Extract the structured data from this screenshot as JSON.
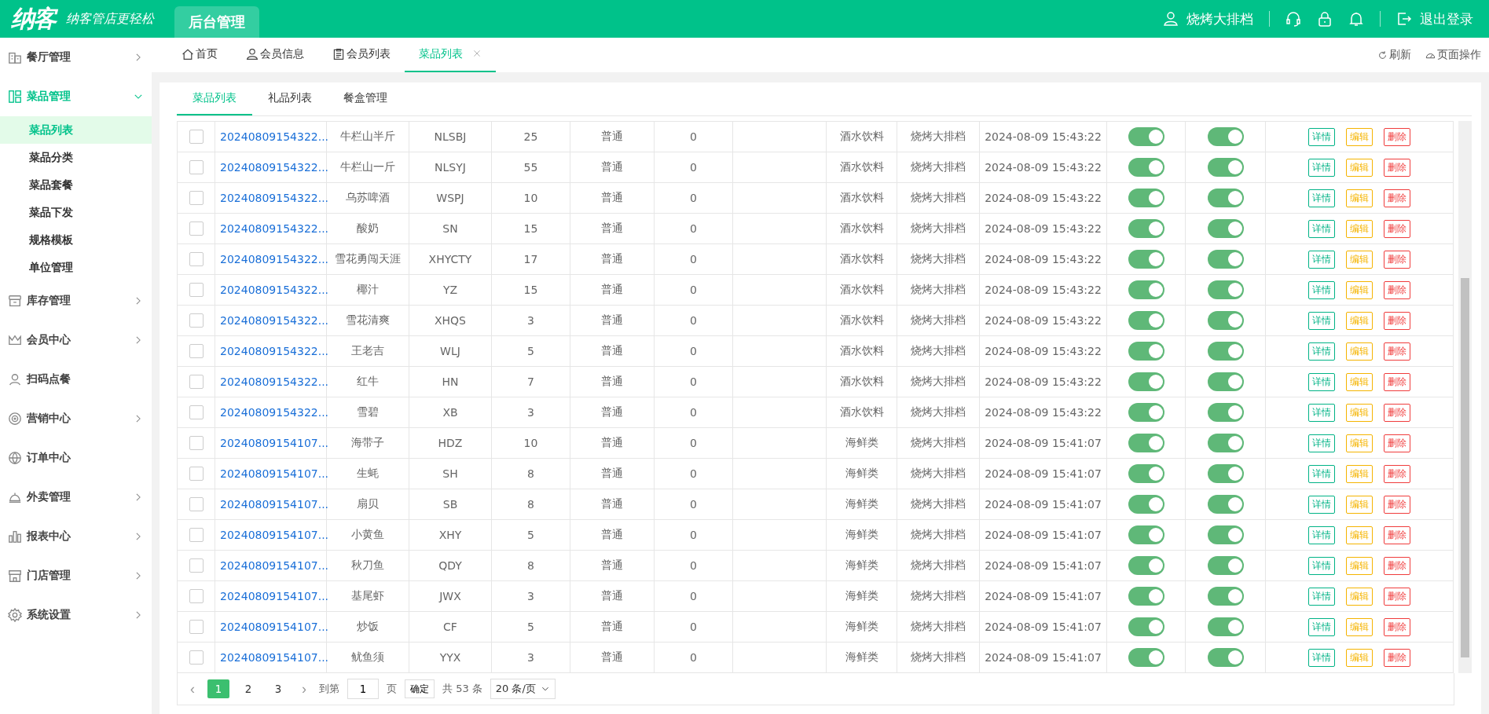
{
  "header": {
    "logo": "纳客",
    "slogan": "纳客管店更轻松",
    "nav": [
      {
        "label": "后台管理",
        "selected": true
      }
    ],
    "user": "烧烤大排档",
    "logout": "退出登录"
  },
  "sidebar": {
    "items": [
      {
        "label": "餐厅管理",
        "expanded": false,
        "has_arrow": true
      },
      {
        "label": "菜品管理",
        "expanded": true,
        "has_arrow": true,
        "children": [
          {
            "label": "菜品列表",
            "selected": true
          },
          {
            "label": "菜品分类",
            "selected": false
          },
          {
            "label": "菜品套餐",
            "selected": false
          },
          {
            "label": "菜品下发",
            "selected": false
          },
          {
            "label": "规格模板",
            "selected": false
          },
          {
            "label": "单位管理",
            "selected": false
          }
        ]
      },
      {
        "label": "库存管理",
        "expanded": false,
        "has_arrow": true
      },
      {
        "label": "会员中心",
        "expanded": false,
        "has_arrow": true
      },
      {
        "label": "扫码点餐",
        "expanded": false,
        "has_arrow": false
      },
      {
        "label": "营销中心",
        "expanded": false,
        "has_arrow": true
      },
      {
        "label": "订单中心",
        "expanded": false,
        "has_arrow": false
      },
      {
        "label": "外卖管理",
        "expanded": false,
        "has_arrow": true
      },
      {
        "label": "报表中心",
        "expanded": false,
        "has_arrow": true
      },
      {
        "label": "门店管理",
        "expanded": false,
        "has_arrow": true
      },
      {
        "label": "系统设置",
        "expanded": false,
        "has_arrow": true
      }
    ]
  },
  "page_tabs": [
    {
      "label": "首页",
      "selected": false,
      "closable": false
    },
    {
      "label": "会员信息",
      "selected": false,
      "closable": false
    },
    {
      "label": "会员列表",
      "selected": false,
      "closable": false
    },
    {
      "label": "菜品列表",
      "selected": true,
      "closable": true
    }
  ],
  "page_actions": [
    {
      "label": "刷新"
    },
    {
      "label": "页面操作"
    }
  ],
  "sub_tabs": [
    {
      "label": "菜品列表",
      "selected": true
    },
    {
      "label": "礼品列表",
      "selected": false
    },
    {
      "label": "餐盒管理",
      "selected": false
    }
  ],
  "table": {
    "rows": [
      {
        "checked": false,
        "number": "20240809154322...",
        "name": "牛栏山半斤",
        "code": "NLSBJ",
        "column_4": "25",
        "column_5": "普通",
        "column_6": "0",
        "category": "酒水饮料",
        "store": "烧烤大排档",
        "time": "2024-08-09 15:43:22",
        "switch_1": true,
        "switch_2": true,
        "actions": [
          {
            "label": "详情",
            "kind": "view"
          },
          {
            "label": "编辑",
            "kind": "edit"
          },
          {
            "label": "删除",
            "kind": "delete"
          }
        ]
      },
      {
        "checked": false,
        "number": "20240809154322...",
        "name": "牛栏山一斤",
        "code": "NLSYJ",
        "column_4": "55",
        "column_5": "普通",
        "column_6": "0",
        "category": "酒水饮料",
        "store": "烧烤大排档",
        "time": "2024-08-09 15:43:22",
        "switch_1": true,
        "switch_2": true,
        "actions": [
          {
            "label": "详情",
            "kind": "view"
          },
          {
            "label": "编辑",
            "kind": "edit"
          },
          {
            "label": "删除",
            "kind": "delete"
          }
        ]
      },
      {
        "checked": false,
        "number": "20240809154322...",
        "name": "乌苏啤酒",
        "code": "WSPJ",
        "column_4": "10",
        "column_5": "普通",
        "column_6": "0",
        "category": "酒水饮料",
        "store": "烧烤大排档",
        "time": "2024-08-09 15:43:22",
        "switch_1": true,
        "switch_2": true,
        "actions": [
          {
            "label": "详情",
            "kind": "view"
          },
          {
            "label": "编辑",
            "kind": "edit"
          },
          {
            "label": "删除",
            "kind": "delete"
          }
        ]
      },
      {
        "checked": false,
        "number": "20240809154322...",
        "name": "酸奶",
        "code": "SN",
        "column_4": "15",
        "column_5": "普通",
        "column_6": "0",
        "category": "酒水饮料",
        "store": "烧烤大排档",
        "time": "2024-08-09 15:43:22",
        "switch_1": true,
        "switch_2": true,
        "actions": [
          {
            "label": "详情",
            "kind": "view"
          },
          {
            "label": "编辑",
            "kind": "edit"
          },
          {
            "label": "删除",
            "kind": "delete"
          }
        ]
      },
      {
        "checked": false,
        "number": "20240809154322...",
        "name": "雪花勇闯天涯",
        "code": "XHYCTY",
        "column_4": "17",
        "column_5": "普通",
        "column_6": "0",
        "category": "酒水饮料",
        "store": "烧烤大排档",
        "time": "2024-08-09 15:43:22",
        "switch_1": true,
        "switch_2": true,
        "actions": [
          {
            "label": "详情",
            "kind": "view"
          },
          {
            "label": "编辑",
            "kind": "edit"
          },
          {
            "label": "删除",
            "kind": "delete"
          }
        ]
      },
      {
        "checked": false,
        "number": "20240809154322...",
        "name": "椰汁",
        "code": "YZ",
        "column_4": "15",
        "column_5": "普通",
        "column_6": "0",
        "category": "酒水饮料",
        "store": "烧烤大排档",
        "time": "2024-08-09 15:43:22",
        "switch_1": true,
        "switch_2": true,
        "actions": [
          {
            "label": "详情",
            "kind": "view"
          },
          {
            "label": "编辑",
            "kind": "edit"
          },
          {
            "label": "删除",
            "kind": "delete"
          }
        ]
      },
      {
        "checked": false,
        "number": "20240809154322...",
        "name": "雪花清爽",
        "code": "XHQS",
        "column_4": "3",
        "column_5": "普通",
        "column_6": "0",
        "category": "酒水饮料",
        "store": "烧烤大排档",
        "time": "2024-08-09 15:43:22",
        "switch_1": true,
        "switch_2": true,
        "actions": [
          {
            "label": "详情",
            "kind": "view"
          },
          {
            "label": "编辑",
            "kind": "edit"
          },
          {
            "label": "删除",
            "kind": "delete"
          }
        ]
      },
      {
        "checked": false,
        "number": "20240809154322...",
        "name": "王老吉",
        "code": "WLJ",
        "column_4": "5",
        "column_5": "普通",
        "column_6": "0",
        "category": "酒水饮料",
        "store": "烧烤大排档",
        "time": "2024-08-09 15:43:22",
        "switch_1": true,
        "switch_2": true,
        "actions": [
          {
            "label": "详情",
            "kind": "view"
          },
          {
            "label": "编辑",
            "kind": "edit"
          },
          {
            "label": "删除",
            "kind": "delete"
          }
        ]
      },
      {
        "checked": false,
        "number": "20240809154322...",
        "name": "红牛",
        "code": "HN",
        "column_4": "7",
        "column_5": "普通",
        "column_6": "0",
        "category": "酒水饮料",
        "store": "烧烤大排档",
        "time": "2024-08-09 15:43:22",
        "switch_1": true,
        "switch_2": true,
        "actions": [
          {
            "label": "详情",
            "kind": "view"
          },
          {
            "label": "编辑",
            "kind": "edit"
          },
          {
            "label": "删除",
            "kind": "delete"
          }
        ]
      },
      {
        "checked": false,
        "number": "20240809154322...",
        "name": "雪碧",
        "code": "XB",
        "column_4": "3",
        "column_5": "普通",
        "column_6": "0",
        "category": "酒水饮料",
        "store": "烧烤大排档",
        "time": "2024-08-09 15:43:22",
        "switch_1": true,
        "switch_2": true,
        "actions": [
          {
            "label": "详情",
            "kind": "view"
          },
          {
            "label": "编辑",
            "kind": "edit"
          },
          {
            "label": "删除",
            "kind": "delete"
          }
        ]
      },
      {
        "checked": false,
        "number": "20240809154107...",
        "name": "海带子",
        "code": "HDZ",
        "column_4": "10",
        "column_5": "普通",
        "column_6": "0",
        "category": "海鲜类",
        "store": "烧烤大排档",
        "time": "2024-08-09 15:41:07",
        "switch_1": true,
        "switch_2": true,
        "actions": [
          {
            "label": "详情",
            "kind": "view"
          },
          {
            "label": "编辑",
            "kind": "edit"
          },
          {
            "label": "删除",
            "kind": "delete"
          }
        ]
      },
      {
        "checked": false,
        "number": "20240809154107...",
        "name": "生蚝",
        "code": "SH",
        "column_4": "8",
        "column_5": "普通",
        "column_6": "0",
        "category": "海鲜类",
        "store": "烧烤大排档",
        "time": "2024-08-09 15:41:07",
        "switch_1": true,
        "switch_2": true,
        "actions": [
          {
            "label": "详情",
            "kind": "view"
          },
          {
            "label": "编辑",
            "kind": "edit"
          },
          {
            "label": "删除",
            "kind": "delete"
          }
        ]
      },
      {
        "checked": false,
        "number": "20240809154107...",
        "name": "扇贝",
        "code": "SB",
        "column_4": "8",
        "column_5": "普通",
        "column_6": "0",
        "category": "海鲜类",
        "store": "烧烤大排档",
        "time": "2024-08-09 15:41:07",
        "switch_1": true,
        "switch_2": true,
        "actions": [
          {
            "label": "详情",
            "kind": "view"
          },
          {
            "label": "编辑",
            "kind": "edit"
          },
          {
            "label": "删除",
            "kind": "delete"
          }
        ]
      },
      {
        "checked": false,
        "number": "20240809154107...",
        "name": "小黄鱼",
        "code": "XHY",
        "column_4": "5",
        "column_5": "普通",
        "column_6": "0",
        "category": "海鲜类",
        "store": "烧烤大排档",
        "time": "2024-08-09 15:41:07",
        "switch_1": true,
        "switch_2": true,
        "actions": [
          {
            "label": "详情",
            "kind": "view"
          },
          {
            "label": "编辑",
            "kind": "edit"
          },
          {
            "label": "删除",
            "kind": "delete"
          }
        ]
      },
      {
        "checked": false,
        "number": "20240809154107...",
        "name": "秋刀鱼",
        "code": "QDY",
        "column_4": "8",
        "column_5": "普通",
        "column_6": "0",
        "category": "海鲜类",
        "store": "烧烤大排档",
        "time": "2024-08-09 15:41:07",
        "switch_1": true,
        "switch_2": true,
        "actions": [
          {
            "label": "详情",
            "kind": "view"
          },
          {
            "label": "编辑",
            "kind": "edit"
          },
          {
            "label": "删除",
            "kind": "delete"
          }
        ]
      },
      {
        "checked": false,
        "number": "20240809154107...",
        "name": "基尾虾",
        "code": "JWX",
        "column_4": "3",
        "column_5": "普通",
        "column_6": "0",
        "category": "海鲜类",
        "store": "烧烤大排档",
        "time": "2024-08-09 15:41:07",
        "switch_1": true,
        "switch_2": true,
        "actions": [
          {
            "label": "详情",
            "kind": "view"
          },
          {
            "label": "编辑",
            "kind": "edit"
          },
          {
            "label": "删除",
            "kind": "delete"
          }
        ]
      },
      {
        "checked": false,
        "number": "20240809154107...",
        "name": "炒饭",
        "code": "CF",
        "column_4": "5",
        "column_5": "普通",
        "column_6": "0",
        "category": "海鲜类",
        "store": "烧烤大排档",
        "time": "2024-08-09 15:41:07",
        "switch_1": true,
        "switch_2": true,
        "actions": [
          {
            "label": "详情",
            "kind": "view"
          },
          {
            "label": "编辑",
            "kind": "edit"
          },
          {
            "label": "删除",
            "kind": "delete"
          }
        ]
      },
      {
        "checked": false,
        "number": "20240809154107...",
        "name": "鱿鱼须",
        "code": "YYX",
        "column_4": "3",
        "column_5": "普通",
        "column_6": "0",
        "category": "海鲜类",
        "store": "烧烤大排档",
        "time": "2024-08-09 15:41:07",
        "switch_1": true,
        "switch_2": true,
        "actions": [
          {
            "label": "详情",
            "kind": "view"
          },
          {
            "label": "编辑",
            "kind": "edit"
          },
          {
            "label": "删除",
            "kind": "delete"
          }
        ]
      }
    ]
  },
  "pagination": {
    "prev": "‹",
    "pages": [
      {
        "label": "1",
        "selected": true
      },
      {
        "label": "2",
        "selected": false
      },
      {
        "label": "3",
        "selected": false
      }
    ],
    "next": "›",
    "goto_label": "到第",
    "goto_value": "1",
    "goto_unit": "页",
    "confirm": "确定",
    "total": "共 53 条",
    "page_size": "20 条/页"
  }
}
